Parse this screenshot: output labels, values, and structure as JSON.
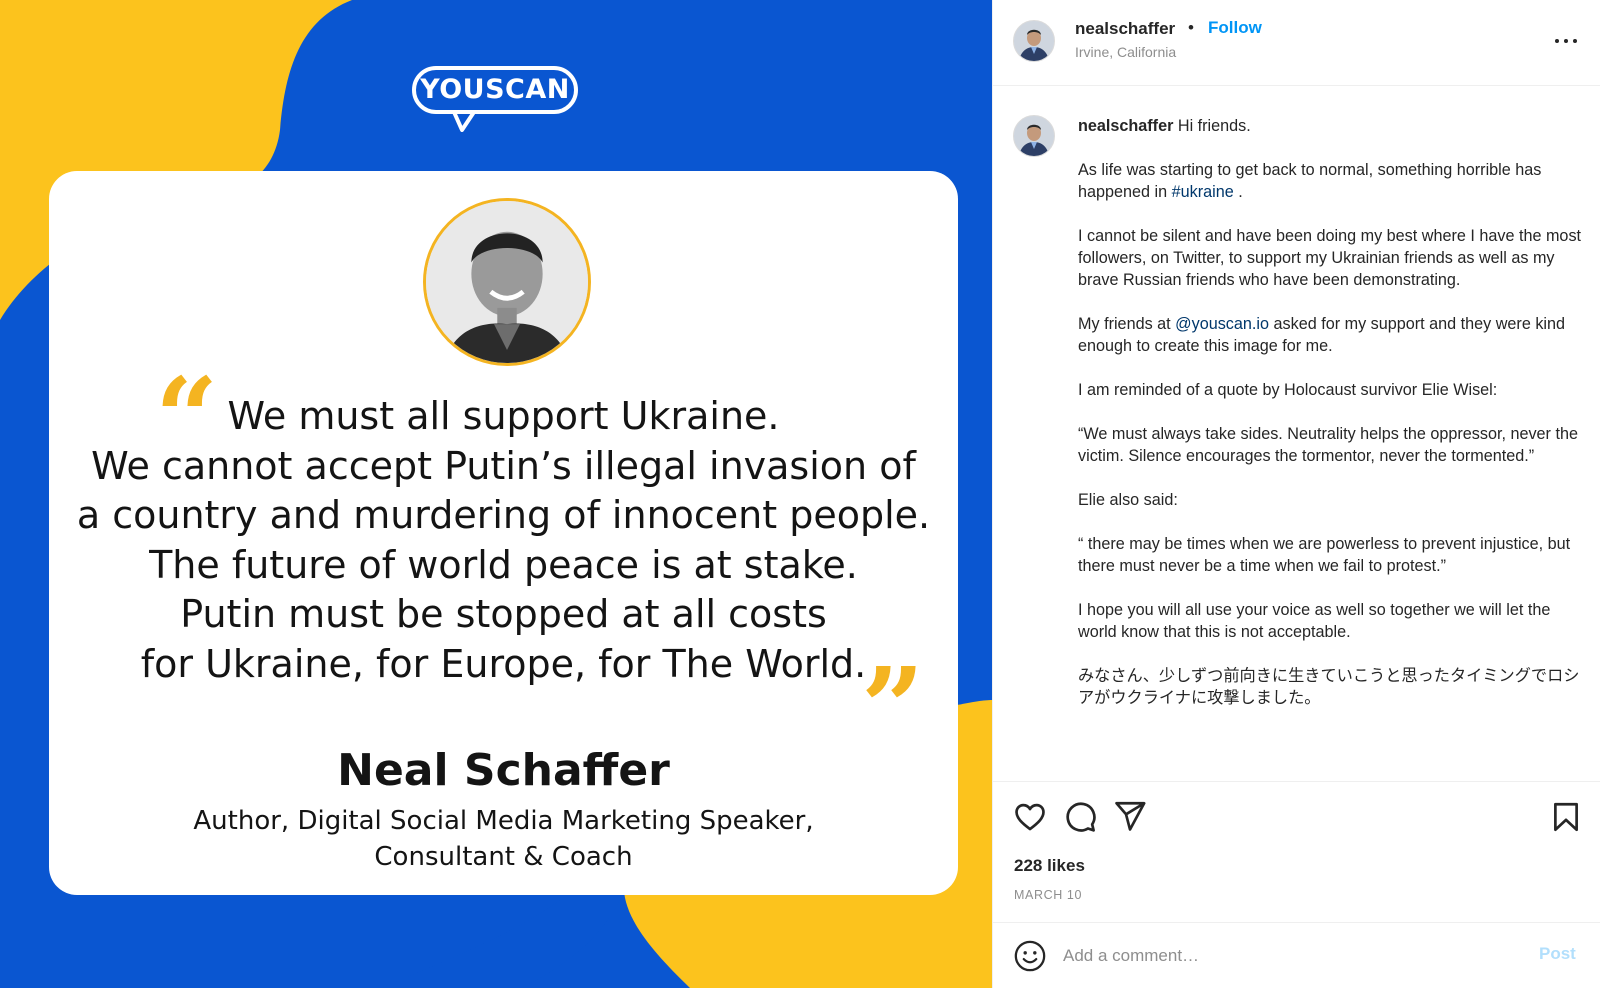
{
  "colors": {
    "ukraine_blue": "#0a56d1",
    "ukraine_yellow": "#fcc31d",
    "quote_mark": "#f4b421",
    "follow_blue": "#0095f6",
    "link_blue": "#00376b"
  },
  "media": {
    "logo_text": "YOUSCAN",
    "quote_lines": [
      "We must all support Ukraine.",
      "We cannot accept Putin’s illegal invasion of",
      "a country and murdering of innocent people.",
      "The future of world peace is at stake.",
      "Putin must be stopped at all costs",
      "for Ukraine, for Europe, for The World."
    ],
    "quote_open_mark": "“",
    "quote_close_mark": "”",
    "author_name": "Neal Schaffer",
    "author_role_line1": "Author, Digital Social Media Marketing Speaker,",
    "author_role_line2": "Consultant & Coach"
  },
  "header": {
    "username": "nealschaffer",
    "separator": "•",
    "follow_label": "Follow",
    "location": "Irvine, California",
    "more_icon": "more-horizontal-icon"
  },
  "caption": {
    "username": "nealschaffer",
    "greeting": "Hi friends.",
    "p1_before": "As life was starting to get back to normal, something horrible has happened in ",
    "p1_hashtag": "#ukraine",
    "p1_after": " .",
    "p2": "I cannot be silent and have been doing my best where I have the most followers, on Twitter, to support my Ukrainian friends as well as my brave Russian friends who have been demonstrating.",
    "p3_before": "My friends at ",
    "p3_mention": "@youscan.io",
    "p3_after": " asked for my support and they were kind enough to create this image for me.",
    "p4": "I am reminded of a quote by Holocaust survivor Elie Wisel:",
    "p5": "“We must always take sides. Neutrality helps the oppressor, never the victim. Silence encourages the tormentor, never the tormented.”",
    "p6": "Elie also said:",
    "p7": "“ there may be times when we are powerless to prevent injustice, but there must never be a time when we fail to protest.”",
    "p8": "I hope you will all use your voice as well so together we will let the world know that this is not acceptable.",
    "p9": "みなさん、少しずつ前向きに生きていこうと思ったタイミングでロシアがウクライナに攻撃しました。"
  },
  "actions": {
    "like_icon": "heart-icon",
    "comment_icon": "comment-icon",
    "share_icon": "send-icon",
    "save_icon": "bookmark-icon",
    "likes": "228 likes",
    "date": "MARCH 10"
  },
  "comment_bar": {
    "emoji_icon": "emoji-icon",
    "placeholder": "Add a comment…",
    "post_label": "Post"
  }
}
